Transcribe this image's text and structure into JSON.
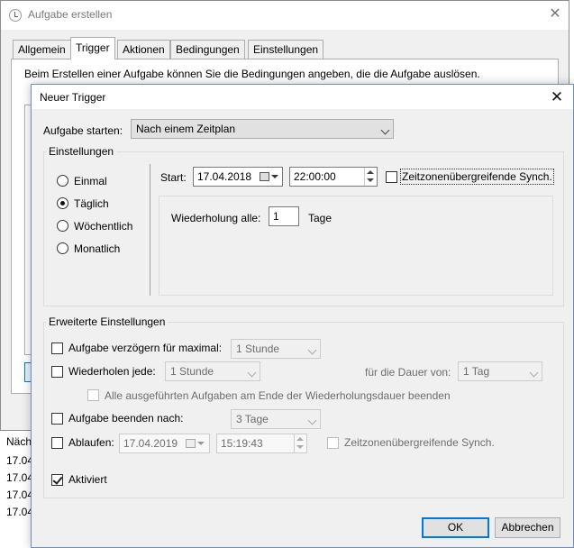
{
  "background_window": {
    "title": "Aufgabe erstellen",
    "tabs": [
      "Allgemein",
      "Trigger",
      "Aktionen",
      "Bedingungen",
      "Einstellungen"
    ],
    "description": "Beim Erstellen einer Aufgabe können Sie die Bedingungen angeben, die die Aufgabe auslösen.",
    "next_label": "Näch",
    "date_rows": [
      "17.04",
      "17.04",
      "17.04",
      "17.04"
    ]
  },
  "dialog": {
    "title": "Neuer Trigger",
    "start_task_label": "Aufgabe starten:",
    "start_task_value": "Nach einem Zeitplan",
    "settings": {
      "title": "Einstellungen",
      "radios": [
        "Einmal",
        "Täglich",
        "Wöchentlich",
        "Monatlich"
      ],
      "selected": "Täglich",
      "start_label": "Start:",
      "start_date": "17.04.2018",
      "start_time": "22:00:00",
      "sync_label": "Zeitzonenübergreifende Synch.",
      "repeat_label": "Wiederholung alle:",
      "repeat_value": "1",
      "repeat_unit": "Tage"
    },
    "advanced": {
      "title": "Erweiterte Einstellungen",
      "delay_label": "Aufgabe verzögern für maximal:",
      "delay_value": "1 Stunde",
      "repeat_every_label": "Wiederholen jede:",
      "repeat_every_value": "1 Stunde",
      "duration_label": "für die Dauer von:",
      "duration_value": "1 Tag",
      "stop_all_label": "Alle ausgeführten Aufgaben am Ende der Wiederholungsdauer beenden",
      "stop_after_label": "Aufgabe beenden nach:",
      "stop_after_value": "3 Tage",
      "expire_label": "Ablaufen:",
      "expire_date": "17.04.2019",
      "expire_time": "15:19:43",
      "expire_sync_label": "Zeitzonenübergreifende Synch.",
      "enabled_label": "Aktiviert"
    },
    "ok_label": "OK",
    "cancel_label": "Abbrechen"
  }
}
